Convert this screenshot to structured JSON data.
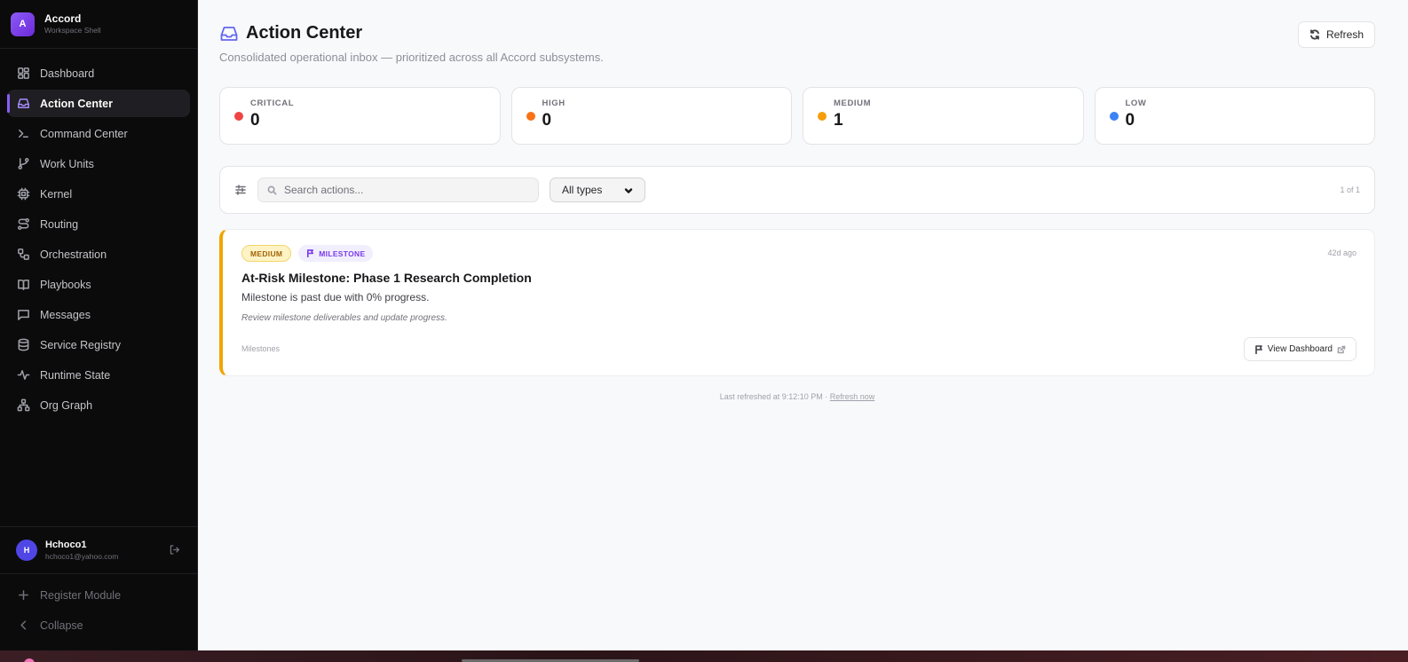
{
  "brand": {
    "logo_letter": "A",
    "name": "Accord",
    "subtitle": "Workspace Shell"
  },
  "sidebar": {
    "items": [
      {
        "label": "Dashboard",
        "icon": "dashboard-icon",
        "active": false
      },
      {
        "label": "Action Center",
        "icon": "inbox-icon",
        "active": true
      },
      {
        "label": "Command Center",
        "icon": "terminal-icon",
        "active": false
      },
      {
        "label": "Work Units",
        "icon": "git-branch-icon",
        "active": false
      },
      {
        "label": "Kernel",
        "icon": "cpu-icon",
        "active": false
      },
      {
        "label": "Routing",
        "icon": "route-icon",
        "active": false
      },
      {
        "label": "Orchestration",
        "icon": "workflow-icon",
        "active": false
      },
      {
        "label": "Playbooks",
        "icon": "book-icon",
        "active": false
      },
      {
        "label": "Messages",
        "icon": "message-icon",
        "active": false
      },
      {
        "label": "Service Registry",
        "icon": "database-icon",
        "active": false
      },
      {
        "label": "Runtime State",
        "icon": "activity-icon",
        "active": false
      },
      {
        "label": "Org Graph",
        "icon": "network-icon",
        "active": false
      }
    ],
    "user": {
      "initial": "H",
      "name": "Hchoco1",
      "email": "hchoco1@yahoo.com"
    },
    "bottom": {
      "register_label": "Register Module",
      "collapse_label": "Collapse"
    }
  },
  "header": {
    "title": "Action Center",
    "subtitle": "Consolidated operational inbox — prioritized across all Accord subsystems.",
    "refresh_label": "Refresh"
  },
  "stats": [
    {
      "label": "CRITICAL",
      "value": "0",
      "color": "#ef4444"
    },
    {
      "label": "HIGH",
      "value": "0",
      "color": "#f97316"
    },
    {
      "label": "MEDIUM",
      "value": "1",
      "color": "#f59e0b"
    },
    {
      "label": "LOW",
      "value": "0",
      "color": "#3b82f6"
    }
  ],
  "filters": {
    "search_placeholder": "Search actions...",
    "type_selected": "All types",
    "pager": "1 of 1"
  },
  "actions": [
    {
      "priority": "MEDIUM",
      "type": "MILESTONE",
      "age": "42d ago",
      "title": "At-Risk Milestone: Phase 1 Research Completion",
      "description": "Milestone is past due with 0% progress.",
      "hint": "Review milestone deliverables and update progress.",
      "source": "Milestones",
      "button_label": "View Dashboard",
      "accent_color": "#f0a500"
    }
  ],
  "footer": {
    "refreshed_text": "Last refreshed at 9:12:10 PM ·",
    "refresh_link": "Refresh now"
  }
}
